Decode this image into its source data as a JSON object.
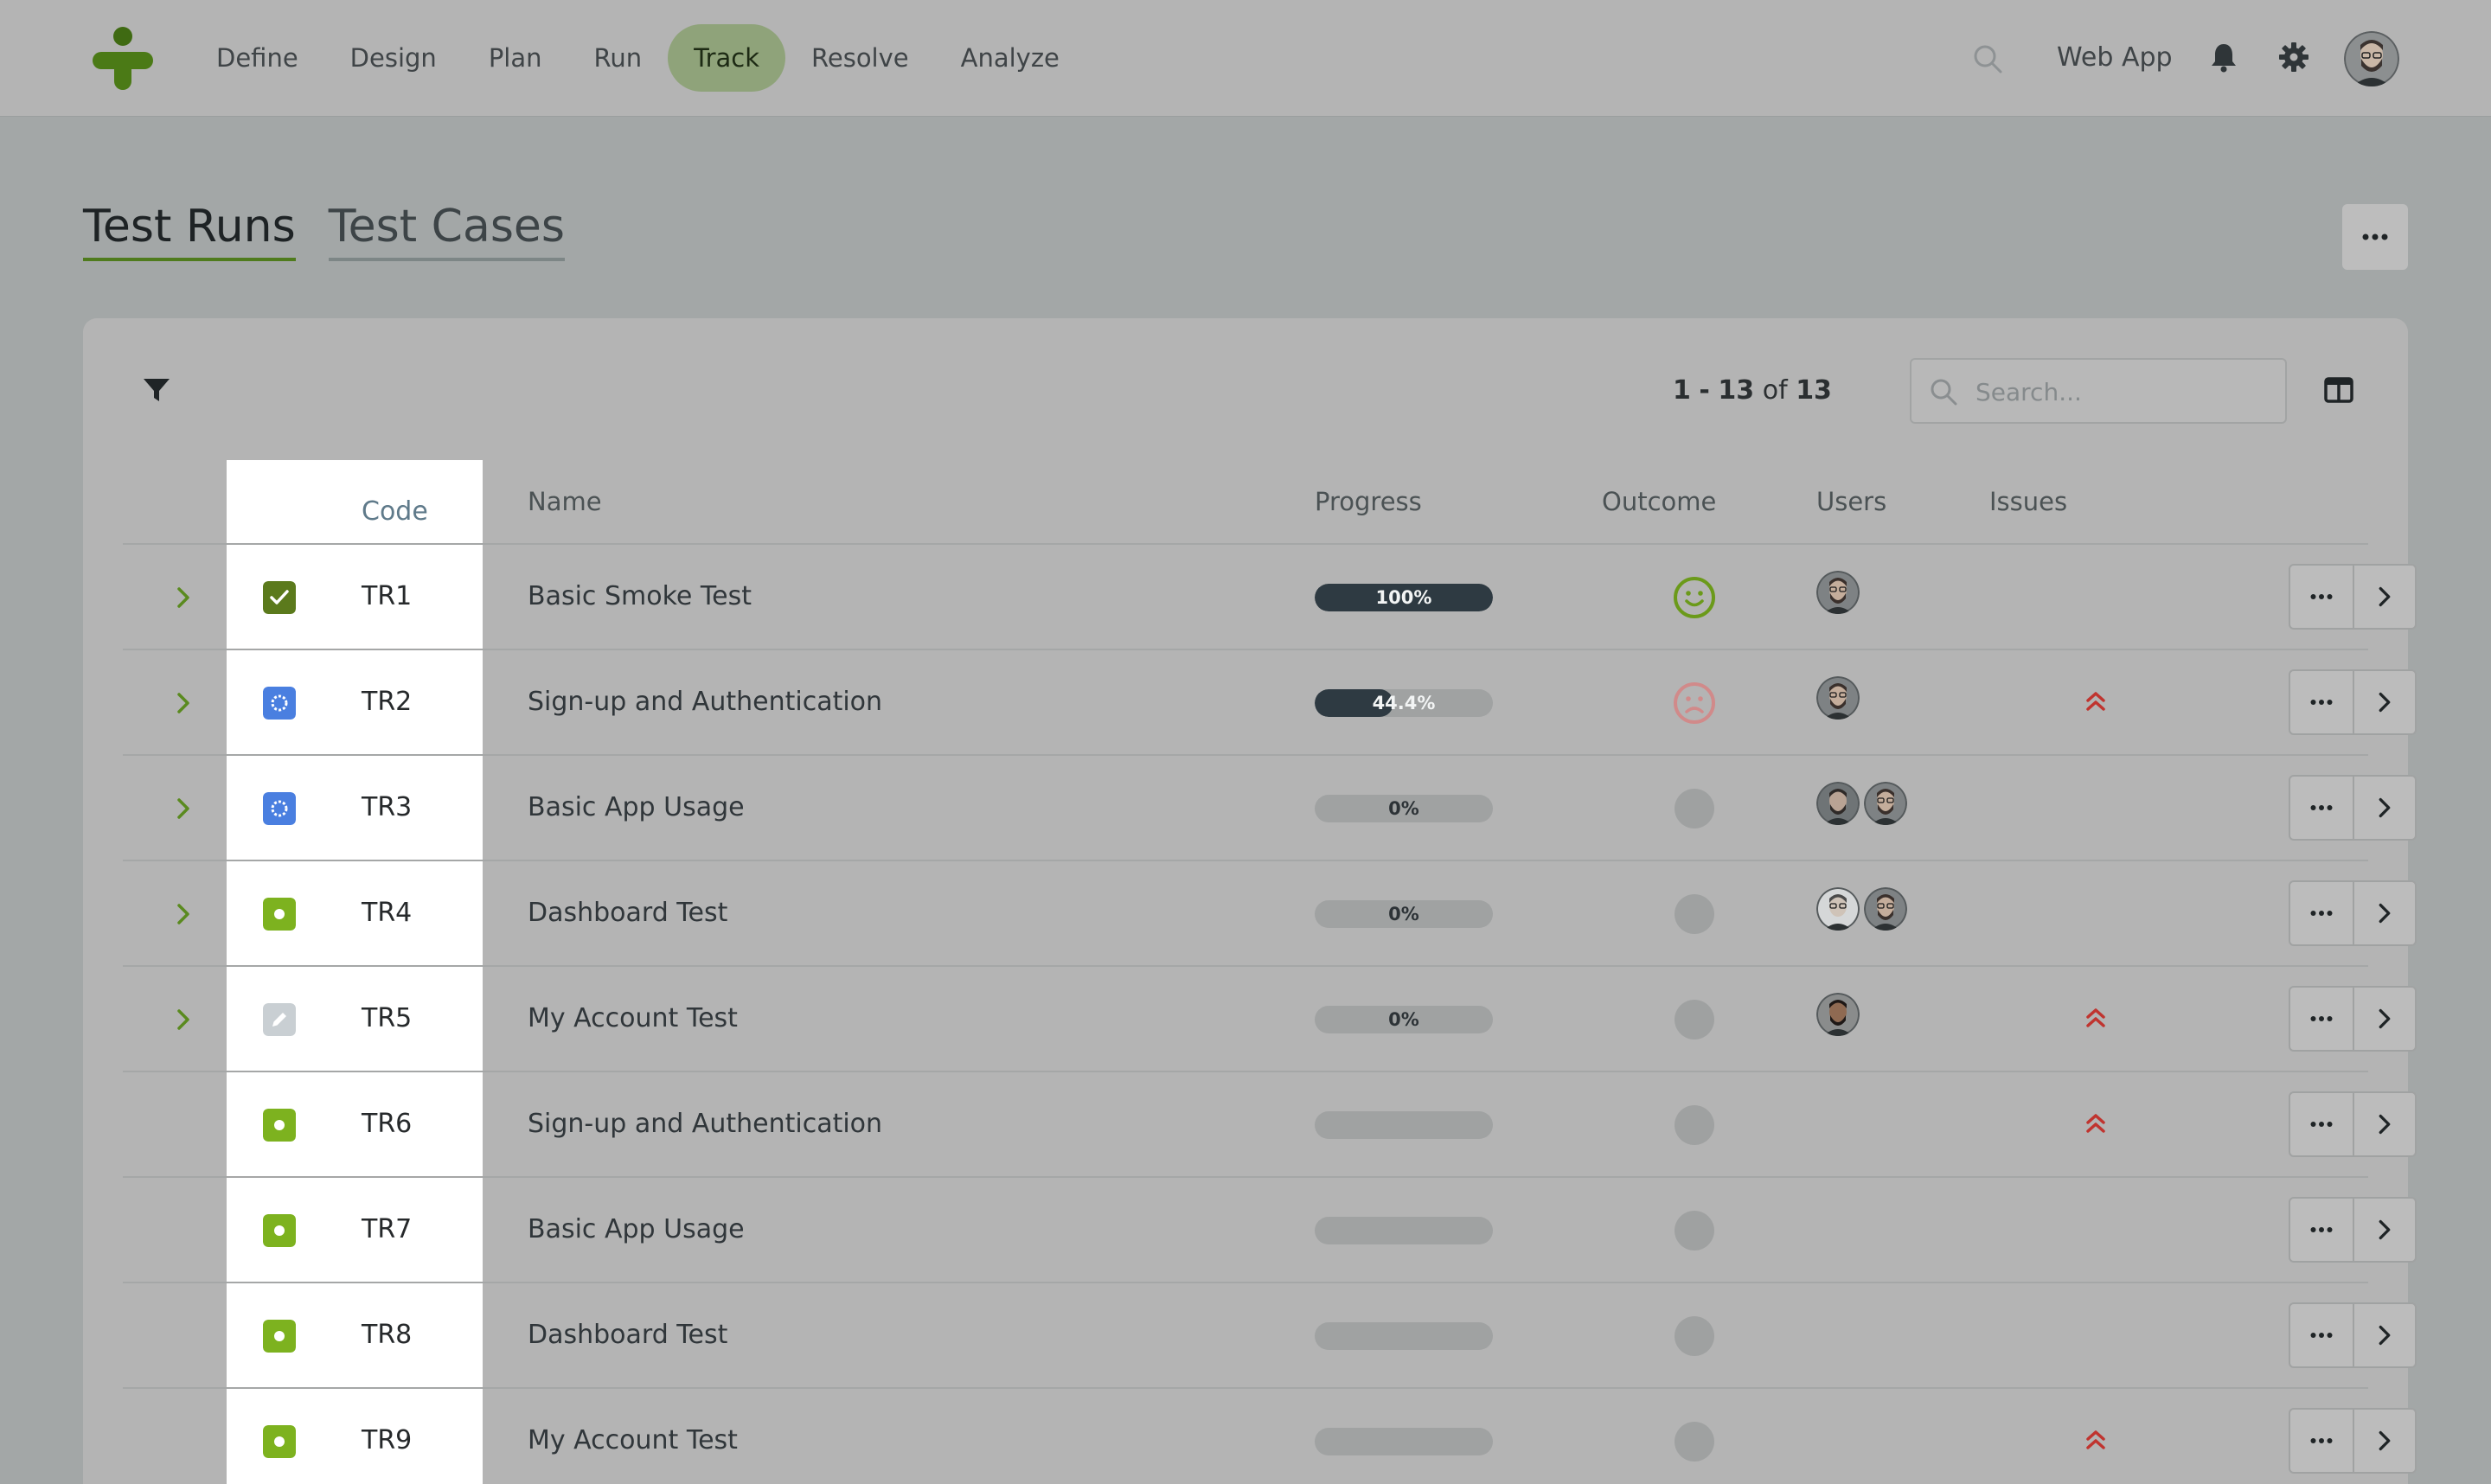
{
  "nav": {
    "items": [
      {
        "label": "Define",
        "active": false
      },
      {
        "label": "Design",
        "active": false
      },
      {
        "label": "Plan",
        "active": false
      },
      {
        "label": "Run",
        "active": false
      },
      {
        "label": "Track",
        "active": true
      },
      {
        "label": "Resolve",
        "active": false
      },
      {
        "label": "Analyze",
        "active": false
      }
    ],
    "workspace": "Web App"
  },
  "tabs": [
    {
      "label": "Test Runs",
      "active": true
    },
    {
      "label": "Test Cases",
      "active": false
    }
  ],
  "toolbar": {
    "pager_from": "1",
    "pager_sep": "-",
    "pager_to": "13",
    "pager_of": "of",
    "pager_total": "13",
    "search_placeholder": "Search..."
  },
  "table": {
    "columns": [
      "Code",
      "Name",
      "Progress",
      "Outcome",
      "Users",
      "Issues"
    ],
    "rows": [
      {
        "code": "TR1",
        "name": "Basic Smoke Test",
        "status": "passed",
        "expandable": true,
        "progress": 100,
        "progress_label": "100%",
        "outcome": "happy",
        "users": [
          "user-a"
        ],
        "issue": false
      },
      {
        "code": "TR2",
        "name": "Sign-up and Authentication",
        "status": "in-progress",
        "expandable": true,
        "progress": 44.4,
        "progress_label": "44.4%",
        "outcome": "sad",
        "users": [
          "user-a"
        ],
        "issue": true
      },
      {
        "code": "TR3",
        "name": "Basic App Usage",
        "status": "in-progress",
        "expandable": true,
        "progress": 0,
        "progress_label": "0%",
        "outcome": "none",
        "users": [
          "user-b",
          "user-a"
        ],
        "issue": false
      },
      {
        "code": "TR4",
        "name": "Dashboard Test",
        "status": "ready",
        "expandable": true,
        "progress": 0,
        "progress_label": "0%",
        "outcome": "none",
        "users": [
          "user-c",
          "user-a"
        ],
        "issue": false
      },
      {
        "code": "TR5",
        "name": "My Account Test",
        "status": "draft",
        "expandable": true,
        "progress": 0,
        "progress_label": "0%",
        "outcome": "none",
        "users": [
          "user-d"
        ],
        "issue": true
      },
      {
        "code": "TR6",
        "name": "Sign-up and Authentication",
        "status": "ready",
        "expandable": false,
        "progress": null,
        "progress_label": "",
        "outcome": "none",
        "users": [],
        "issue": true
      },
      {
        "code": "TR7",
        "name": "Basic App Usage",
        "status": "ready",
        "expandable": false,
        "progress": null,
        "progress_label": "",
        "outcome": "none",
        "users": [],
        "issue": false
      },
      {
        "code": "TR8",
        "name": "Dashboard Test",
        "status": "ready",
        "expandable": false,
        "progress": null,
        "progress_label": "",
        "outcome": "none",
        "users": [],
        "issue": false
      },
      {
        "code": "TR9",
        "name": "My Account Test",
        "status": "ready",
        "expandable": false,
        "progress": null,
        "progress_label": "",
        "outcome": "none",
        "users": [],
        "issue": true
      }
    ]
  },
  "icons": {
    "logo": "plus-logo-icon",
    "search": "search-icon",
    "bell": "bell-icon",
    "settings": "gear-icon",
    "filter": "filter-icon",
    "columns": "columns-icon",
    "expand": "chevron-right-icon",
    "more": "ellipsis-icon",
    "open": "chevron-right-icon",
    "issue": "double-chevron-up-icon"
  },
  "colors": {
    "accent_green": "#5a8a1f",
    "status_passed": "#5b7a1c",
    "status_in_progress": "#4a7fe0",
    "status_ready": "#7db21f",
    "status_draft": "#c9cfd3",
    "outcome_happy": "#6b9a1a",
    "outcome_sad": "#d18a8a",
    "issue_red": "#c0342f",
    "progress_fill": "#2e3a42"
  }
}
